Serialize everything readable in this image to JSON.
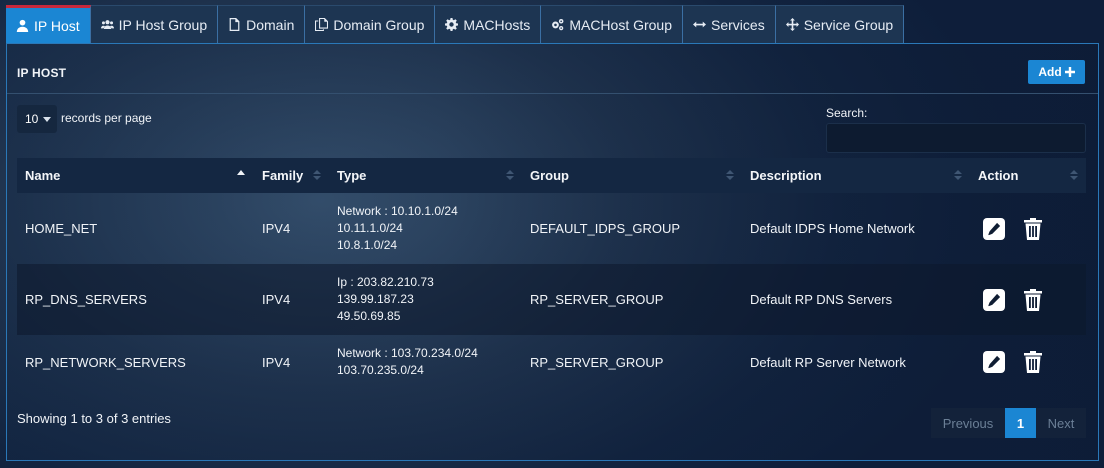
{
  "tabs": [
    {
      "label": "IP Host",
      "icon": "user-icon",
      "active": true
    },
    {
      "label": "IP Host Group",
      "icon": "users-icon"
    },
    {
      "label": "Domain",
      "icon": "file-icon"
    },
    {
      "label": "Domain Group",
      "icon": "files-icon"
    },
    {
      "label": "MACHosts",
      "icon": "gear-icon"
    },
    {
      "label": "MACHost Group",
      "icon": "gears-icon"
    },
    {
      "label": "Services",
      "icon": "arrows-h-icon"
    },
    {
      "label": "Service Group",
      "icon": "arrows-cross-icon"
    }
  ],
  "panel": {
    "title": "IP HOST",
    "add_label": "Add"
  },
  "controls": {
    "page_length": "10",
    "page_length_label": "records per page",
    "search_label": "Search:",
    "search_value": ""
  },
  "table": {
    "columns": [
      "Name",
      "Family",
      "Type",
      "Group",
      "Description",
      "Action"
    ],
    "sorted_column": "Name",
    "rows": [
      {
        "name": "HOME_NET",
        "family": "IPV4",
        "type_lines": [
          "Network : 10.10.1.0/24",
          "10.11.1.0/24",
          "10.8.1.0/24"
        ],
        "group": "DEFAULT_IDPS_GROUP",
        "description": "Default IDPS Home Network"
      },
      {
        "name": "RP_DNS_SERVERS",
        "family": "IPV4",
        "type_lines": [
          "Ip : 203.82.210.73",
          "139.99.187.23",
          "49.50.69.85"
        ],
        "group": "RP_SERVER_GROUP",
        "description": "Default RP DNS Servers"
      },
      {
        "name": "RP_NETWORK_SERVERS",
        "family": "IPV4",
        "type_lines": [
          "Network : 103.70.234.0/24",
          "103.70.235.0/24"
        ],
        "group": "RP_SERVER_GROUP",
        "description": "Default RP Server Network"
      }
    ]
  },
  "footer": {
    "info": "Showing 1 to 3 of 3 entries",
    "prev_label": "Previous",
    "current_page": "1",
    "next_label": "Next"
  },
  "colors": {
    "accent": "#1b86d3",
    "active_tab_top": "#c8283c",
    "header_bg": "#142742"
  }
}
